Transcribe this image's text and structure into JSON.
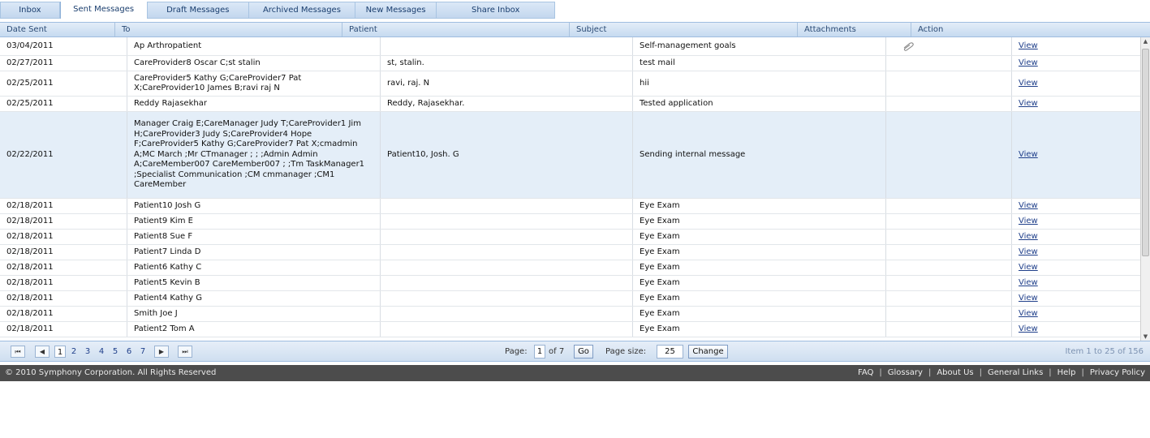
{
  "tabs": [
    "Inbox",
    "Sent Messages",
    "Draft Messages",
    "Archived Messages",
    "New Messages",
    "Share Inbox"
  ],
  "columns": [
    "Date Sent",
    "To",
    "Patient",
    "Subject",
    "Attachments",
    "Action"
  ],
  "rows": [
    {
      "date": "03/04/2011",
      "to": "Ap Arthropatient",
      "patient": "",
      "subject": "Self-management goals",
      "attachment": true,
      "action": "View"
    },
    {
      "date": "02/27/2011",
      "to": "CareProvider8 Oscar C;st stalin",
      "patient": "st, stalin.",
      "subject": "test mail",
      "attachment": false,
      "action": "View"
    },
    {
      "date": "02/25/2011",
      "to": "CareProvider5 Kathy G;CareProvider7 Pat X;CareProvider10 James B;ravi raj N",
      "patient": "ravi, raj. N",
      "subject": "hii",
      "attachment": false,
      "action": "View"
    },
    {
      "date": "02/25/2011",
      "to": "Reddy Rajasekhar",
      "patient": "Reddy, Rajasekhar.",
      "subject": "Tested application",
      "attachment": false,
      "action": "View"
    },
    {
      "date": "02/22/2011",
      "to": "Manager Craig E;CareManager Judy T;CareProvider1 Jim H;CareProvider3 Judy S;CareProvider4 Hope F;CareProvider5 Kathy G;CareProvider7 Pat X;cmadmin A;MC March ;Mr CTmanager ; ; ;Admin Admin A;CareMember007 CareMember007 ; ;Tm TaskManager1 ;Specialist Communication ;CM cmmanager ;CM1 CareMember",
      "patient": "Patient10, Josh. G",
      "subject": "Sending internal message",
      "attachment": false,
      "action": "View"
    },
    {
      "date": "02/18/2011",
      "to": "Patient10 Josh G",
      "patient": "",
      "subject": "Eye Exam",
      "attachment": false,
      "action": "View"
    },
    {
      "date": "02/18/2011",
      "to": "Patient9 Kim E",
      "patient": "",
      "subject": "Eye Exam",
      "attachment": false,
      "action": "View"
    },
    {
      "date": "02/18/2011",
      "to": "Patient8 Sue F",
      "patient": "",
      "subject": "Eye Exam",
      "attachment": false,
      "action": "View"
    },
    {
      "date": "02/18/2011",
      "to": "Patient7 Linda D",
      "patient": "",
      "subject": "Eye Exam",
      "attachment": false,
      "action": "View"
    },
    {
      "date": "02/18/2011",
      "to": "Patient6 Kathy C",
      "patient": "",
      "subject": "Eye Exam",
      "attachment": false,
      "action": "View"
    },
    {
      "date": "02/18/2011",
      "to": "Patient5 Kevin B",
      "patient": "",
      "subject": "Eye Exam",
      "attachment": false,
      "action": "View"
    },
    {
      "date": "02/18/2011",
      "to": "Patient4 Kathy G",
      "patient": "",
      "subject": "Eye Exam",
      "attachment": false,
      "action": "View"
    },
    {
      "date": "02/18/2011",
      "to": "Smith Joe J",
      "patient": "",
      "subject": "Eye Exam",
      "attachment": false,
      "action": "View"
    },
    {
      "date": "02/18/2011",
      "to": "Patient2 Tom A",
      "patient": "",
      "subject": "Eye Exam",
      "attachment": false,
      "action": "View"
    }
  ],
  "pager": {
    "pages": [
      "1",
      "2",
      "3",
      "4",
      "5",
      "6",
      "7"
    ],
    "current_page": "1",
    "page_label": "Page:",
    "page_value": "1",
    "of_label": "of 7",
    "go_label": "Go",
    "page_size_label": "Page size:",
    "page_size_value": "25",
    "change_label": "Change",
    "info": "Item 1 to 25 of 156"
  },
  "footer": {
    "copyright": "© 2010 Symphony Corporation. All Rights Reserved",
    "links": [
      "FAQ",
      "Glossary",
      "About Us",
      "General Links",
      "Help",
      "Privacy Policy"
    ]
  },
  "colors": {
    "header_bg": "#c6daf0",
    "selected_row": "#e4eef8",
    "footer_bg": "#4c4c4c",
    "link": "#1f3f8a"
  }
}
